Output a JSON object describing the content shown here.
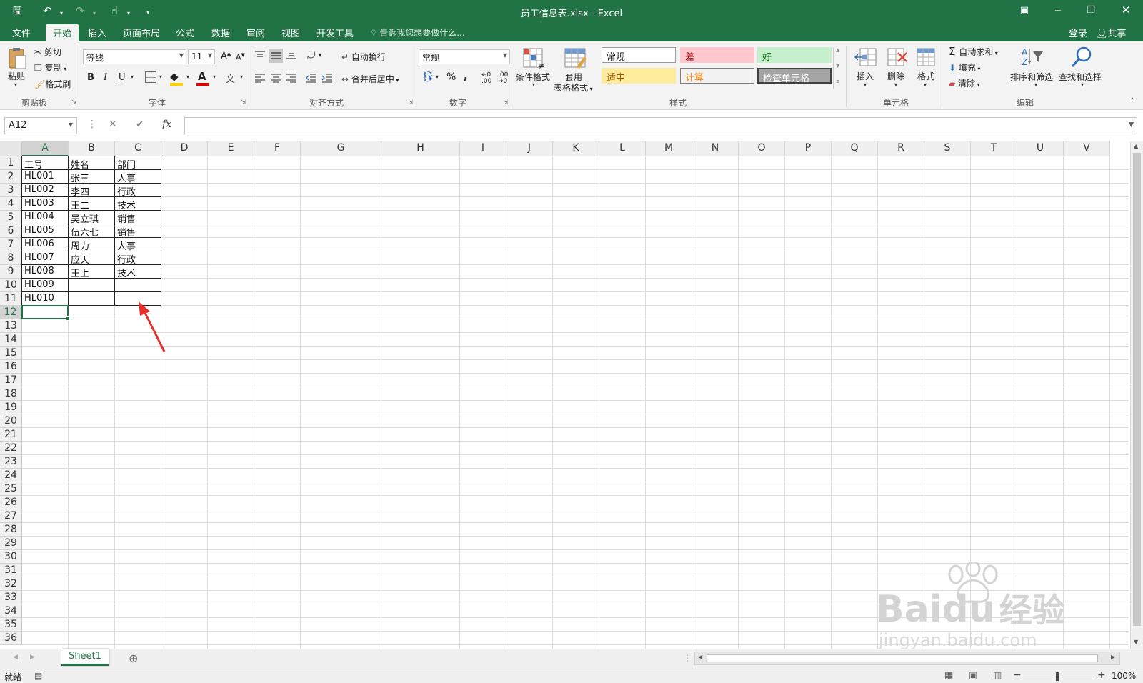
{
  "window": {
    "title": "员工信息表.xlsx - Excel"
  },
  "tabs": [
    "文件",
    "开始",
    "插入",
    "页面布局",
    "公式",
    "数据",
    "审阅",
    "视图",
    "开发工具"
  ],
  "active_tab": "开始",
  "tell_me": "告诉我您想要做什么...",
  "account": {
    "signin": "登录",
    "share": "共享"
  },
  "clipboard": {
    "paste": "粘贴",
    "cut": "剪切",
    "copy": "复制",
    "painter": "格式刷",
    "label": "剪贴板"
  },
  "font": {
    "name": "等线",
    "size": "11",
    "bold": "B",
    "italic": "I",
    "underline": "U",
    "grow": "A",
    "shrink": "A",
    "label": "字体",
    "font_color": "#e00000",
    "fill_color": "#ffd200"
  },
  "alignment": {
    "wrap": "自动换行",
    "merge": "合并后居中",
    "label": "对齐方式"
  },
  "number": {
    "format": "常规",
    "percent": "%",
    "comma": ",",
    "label": "数字"
  },
  "styles": {
    "conditional": "条件格式",
    "table1": "套用",
    "table2": "表格格式",
    "label": "样式",
    "cells": [
      {
        "text": "常规",
        "bg": "#ffffff",
        "fg": "#222222",
        "border": "#9b9b9b"
      },
      {
        "text": "差",
        "bg": "#ffc7ce",
        "fg": "#9c0006",
        "border": "#ffc7ce"
      },
      {
        "text": "好",
        "bg": "#c6efce",
        "fg": "#006100",
        "border": "#c6efce"
      },
      {
        "text": "适中",
        "bg": "#ffeb9c",
        "fg": "#9c5700",
        "border": "#ffeb9c"
      },
      {
        "text": "计算",
        "bg": "#f2f2f2",
        "fg": "#fa7d00",
        "border": "#7f7f7f"
      },
      {
        "text": "检查单元格",
        "bg": "#a5a5a5",
        "fg": "#ffffff",
        "border": "#3f3f3f"
      }
    ]
  },
  "cells_group": {
    "insert": "插入",
    "delete": "删除",
    "format": "格式",
    "label": "单元格"
  },
  "editing": {
    "autosum": "自动求和",
    "fill": "填充",
    "clear": "清除",
    "sort": "排序和筛选",
    "find": "查找和选择",
    "label": "编辑"
  },
  "formula_bar": {
    "name_box": "A12",
    "fx": "fx",
    "value": ""
  },
  "columns": [
    "A",
    "B",
    "C",
    "D",
    "E",
    "F",
    "G",
    "H",
    "I",
    "J",
    "K",
    "L",
    "M",
    "N",
    "O",
    "P",
    "Q",
    "R",
    "S",
    "T",
    "U",
    "V"
  ],
  "rows": [
    "1",
    "2",
    "3",
    "4",
    "5",
    "6",
    "7",
    "8",
    "9",
    "10",
    "11",
    "12",
    "13",
    "14",
    "15",
    "16",
    "17",
    "18",
    "19",
    "20",
    "21",
    "22",
    "23",
    "24",
    "25",
    "26",
    "27",
    "28",
    "29",
    "30",
    "31",
    "32",
    "33",
    "34",
    "35",
    "36"
  ],
  "table": [
    [
      "工号",
      "姓名",
      "部门"
    ],
    [
      "HL001",
      "张三",
      "人事"
    ],
    [
      "HL002",
      "李四",
      "行政"
    ],
    [
      "HL003",
      "王二",
      "技术"
    ],
    [
      "HL004",
      "吴立琪",
      "销售"
    ],
    [
      "HL005",
      "伍六七",
      "销售"
    ],
    [
      "HL006",
      "周力",
      "人事"
    ],
    [
      "HL007",
      "应天",
      "行政"
    ],
    [
      "HL008",
      "王上",
      "技术"
    ],
    [
      "HL009",
      "",
      ""
    ],
    [
      "HL010",
      "",
      ""
    ]
  ],
  "annotation_color": "#e8302a",
  "sheet_tabs": [
    "Sheet1"
  ],
  "status": {
    "ready": "就绪",
    "zoom": "100%"
  },
  "watermark": {
    "brand": "Baidu",
    "cn": "经验",
    "url": "jingyan.baidu.com"
  }
}
